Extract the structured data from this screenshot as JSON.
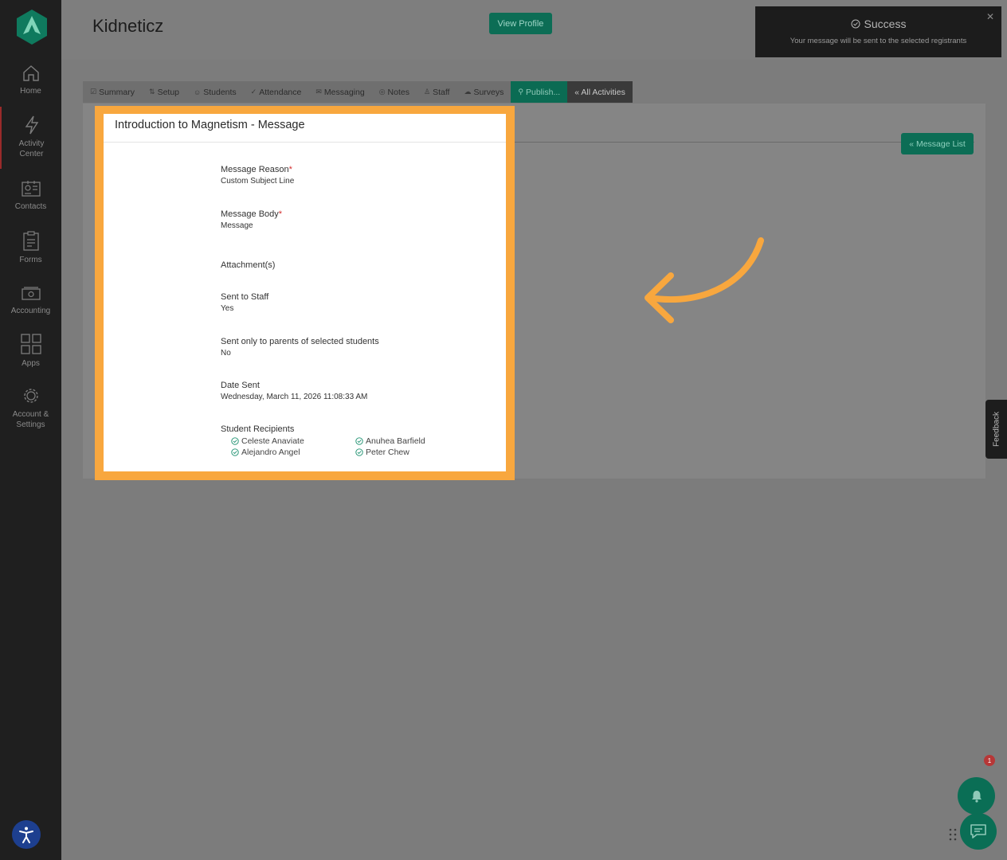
{
  "sidebar": {
    "items": [
      {
        "label": "Home",
        "icon": "home-icon"
      },
      {
        "label": "Activity Center",
        "icon": "lightning-icon"
      },
      {
        "label": "Contacts",
        "icon": "contacts-icon"
      },
      {
        "label": "Forms",
        "icon": "forms-icon"
      },
      {
        "label": "Accounting",
        "icon": "money-icon"
      },
      {
        "label": "Apps",
        "icon": "apps-grid-icon"
      },
      {
        "label": "Account & Settings",
        "icon": "gear-icon"
      }
    ]
  },
  "header": {
    "title": "Kidneticz",
    "view_profile_label": "View Profile"
  },
  "toast": {
    "title": "Success",
    "message": "Your message will be sent to the selected registrants"
  },
  "tabs": [
    {
      "label": "Summary",
      "icon": "☑"
    },
    {
      "label": "Setup",
      "icon": "⇅"
    },
    {
      "label": "Students",
      "icon": "☺"
    },
    {
      "label": "Attendance",
      "icon": "✓"
    },
    {
      "label": "Messaging",
      "icon": "✉"
    },
    {
      "label": "Notes",
      "icon": "◎"
    },
    {
      "label": "Staff",
      "icon": "♙"
    },
    {
      "label": "Surveys",
      "icon": "☁"
    },
    {
      "label": "Publish...",
      "icon": "⚲"
    },
    {
      "label": "« All Activities",
      "icon": ""
    }
  ],
  "message_list_label": "« Message List",
  "modal": {
    "title": "Introduction to Magnetism - Message",
    "fields": {
      "reason_label": "Message Reason",
      "reason_value": "Custom Subject Line",
      "body_label": "Message Body",
      "body_value": "Message",
      "attachments_label": "Attachment(s)",
      "staff_label": "Sent to Staff",
      "staff_value": "Yes",
      "parents_label": "Sent only to parents of selected students",
      "parents_value": "No",
      "date_label": "Date Sent",
      "date_value": "Wednesday, March 11, 2026 11:08:33 AM",
      "recipients_label": "Student Recipients",
      "required_mark": "*"
    },
    "recipients": [
      "Celeste Anaviate",
      "Anuhea Barfield",
      "Alejandro Angel",
      "Peter Chew"
    ]
  },
  "feedback_label": "Feedback",
  "notification_count": "1",
  "colors": {
    "accent": "#0c6d55",
    "highlight": "#f8a73e",
    "sidebar": "#1f1f1f"
  }
}
